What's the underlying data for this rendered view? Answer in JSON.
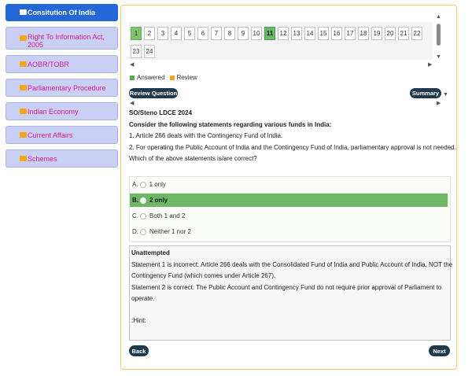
{
  "sidebar": {
    "items": [
      {
        "label": "Consitution Of India",
        "active": true
      },
      {
        "label": "Right To Information Act, 2005",
        "active": false
      },
      {
        "label": "AOBR/TOBR",
        "active": false
      },
      {
        "label": "Parliamentary Procedure",
        "active": false
      },
      {
        "label": "Indian Economy",
        "active": false
      },
      {
        "label": "Current Affairs",
        "active": false
      },
      {
        "label": "Schemes",
        "active": false
      }
    ]
  },
  "palette": {
    "numbers": [
      "1",
      "2",
      "3",
      "4",
      "5",
      "6",
      "7",
      "8",
      "9",
      "10",
      "11",
      "12",
      "13",
      "14",
      "15",
      "16",
      "17",
      "18",
      "19",
      "20",
      "21",
      "22",
      "23",
      "24"
    ],
    "answered": [
      "1"
    ],
    "current": "11"
  },
  "legend": {
    "answered_label": "Answered",
    "review_label": "Review",
    "answered_color": "#5cab4e",
    "review_color": "#f2a719"
  },
  "buttons": {
    "review_question": "Review Question",
    "summary": "Summary",
    "back": "Back",
    "next": "Next"
  },
  "question": {
    "exam": "SO/Steno LDCE 2024",
    "stem": "Consider the following statements regarding various funds in India:",
    "statement1": "1. Article 266 deals with the Contingency Fund of India.",
    "statement2": "2. For operating the Public Account of India and the Contingency Fund of India, parliamentary approval is not needed.",
    "prompt": "Which of the above statements is/are correct?"
  },
  "options": [
    {
      "letter": "A.",
      "text": "1 only",
      "selected": false
    },
    {
      "letter": "B.",
      "text": "2 only",
      "selected": true
    },
    {
      "letter": "C.",
      "text": "Both 1 and 2",
      "selected": false
    },
    {
      "letter": "D.",
      "text": "Neither 1 nor 2",
      "selected": false
    }
  ],
  "explanation": {
    "status": "Unattempted",
    "line1": "Statement 1 is incorrect: Article 266 deals with the Consolidated Fund of India and Public Account of India, NOT the",
    "line2": "Contingency Fund (which comes under Article 267).",
    "line3": "Statement 2 is correct: The Public Account and Contingency Fund do not require prior approval of Parliament to",
    "line4": "operate.",
    "hint": ":Hint:"
  }
}
